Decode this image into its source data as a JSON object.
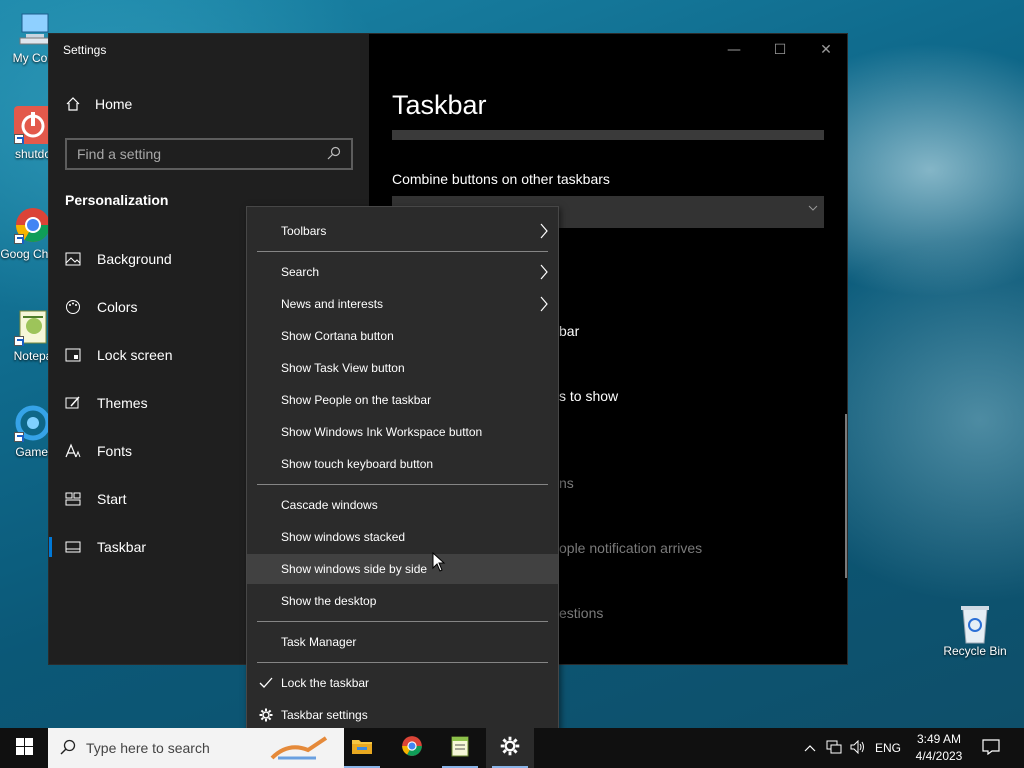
{
  "desktop": {
    "icons": [
      {
        "label": "My Com"
      },
      {
        "label": "shutdo"
      },
      {
        "label": "Goog Chron"
      },
      {
        "label": "Notepa"
      },
      {
        "label": "Gamel"
      },
      {
        "label": "Recycle Bin"
      }
    ]
  },
  "window": {
    "title": "Settings",
    "controls": {
      "minimize": "—",
      "maximize": "☐",
      "close": "✕"
    }
  },
  "sidebar": {
    "home_label": "Home",
    "search_placeholder": "Find a setting",
    "section_title": "Personalization",
    "items": [
      {
        "label": "Background",
        "icon": "image-icon"
      },
      {
        "label": "Colors",
        "icon": "palette-icon"
      },
      {
        "label": "Lock screen",
        "icon": "lock-screen-icon"
      },
      {
        "label": "Themes",
        "icon": "themes-icon"
      },
      {
        "label": "Fonts",
        "icon": "fonts-icon"
      },
      {
        "label": "Start",
        "icon": "start-icon"
      },
      {
        "label": "Taskbar",
        "icon": "taskbar-icon",
        "active": true
      }
    ]
  },
  "main": {
    "title": "Taskbar",
    "combine_label": "Combine buttons on other taskbars",
    "fragments": {
      "f1": "bar",
      "f2": "s to show",
      "f3": "ns",
      "f4": "ople notification arrives",
      "f5": "estions"
    }
  },
  "context_menu": {
    "items": {
      "toolbars": "Toolbars",
      "search": "Search",
      "news": "News and interests",
      "cortana": "Show Cortana button",
      "task_view": "Show Task View button",
      "people": "Show People on the taskbar",
      "ink": "Show Windows Ink Workspace button",
      "touch_keyboard": "Show touch keyboard button",
      "cascade": "Cascade windows",
      "stacked": "Show windows stacked",
      "side_by_side": "Show windows side by side",
      "desktop": "Show the desktop",
      "task_manager": "Task Manager",
      "lock": "Lock the taskbar",
      "taskbar_settings": "Taskbar settings"
    },
    "hovered": "side_by_side",
    "checked": "lock"
  },
  "taskbar": {
    "search_placeholder": "Type here to search",
    "language": "ENG",
    "time": "3:49 AM",
    "date": "4/4/2023",
    "accent": "#0078d7"
  }
}
